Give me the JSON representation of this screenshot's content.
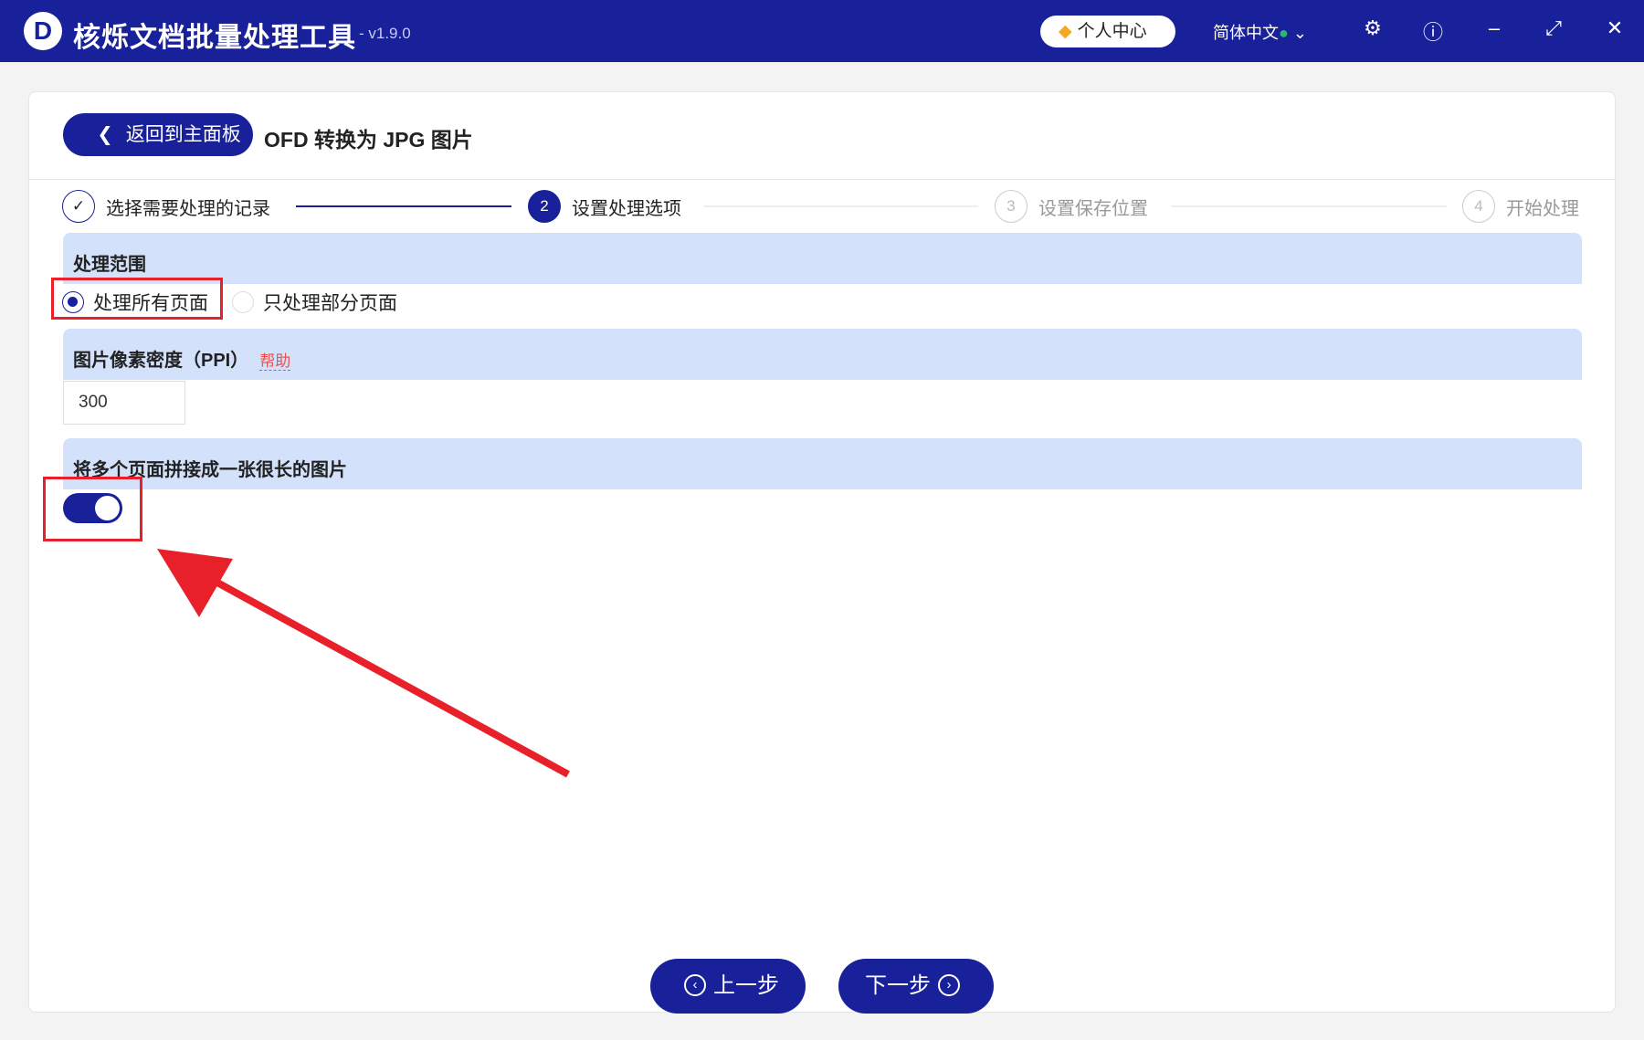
{
  "app": {
    "logo_letter": "D",
    "title": "核烁文档批量处理工具",
    "version": "- v1.9.0",
    "user_center": "个人中心",
    "language": "简体中文"
  },
  "page": {
    "back_label": "返回到主面板",
    "title": "OFD 转换为 JPG 图片"
  },
  "steps": [
    {
      "num": "✓",
      "label": "选择需要处理的记录",
      "state": "done"
    },
    {
      "num": "2",
      "label": "设置处理选项",
      "state": "active"
    },
    {
      "num": "3",
      "label": "设置保存位置",
      "state": "todo"
    },
    {
      "num": "4",
      "label": "开始处理",
      "state": "todo"
    }
  ],
  "range": {
    "title": "处理范围",
    "options": [
      "处理所有页面",
      "只处理部分页面"
    ],
    "selected": 0
  },
  "ppi": {
    "title": "图片像素密度（PPI）",
    "help": "帮助",
    "value": "300"
  },
  "merge": {
    "title": "将多个页面拼接成一张很长的图片",
    "enabled": true
  },
  "nav": {
    "prev": "上一步",
    "next": "下一步"
  },
  "colors": {
    "primary": "#18209a",
    "section": "#d3e1fb",
    "annotation": "#e8202a"
  }
}
